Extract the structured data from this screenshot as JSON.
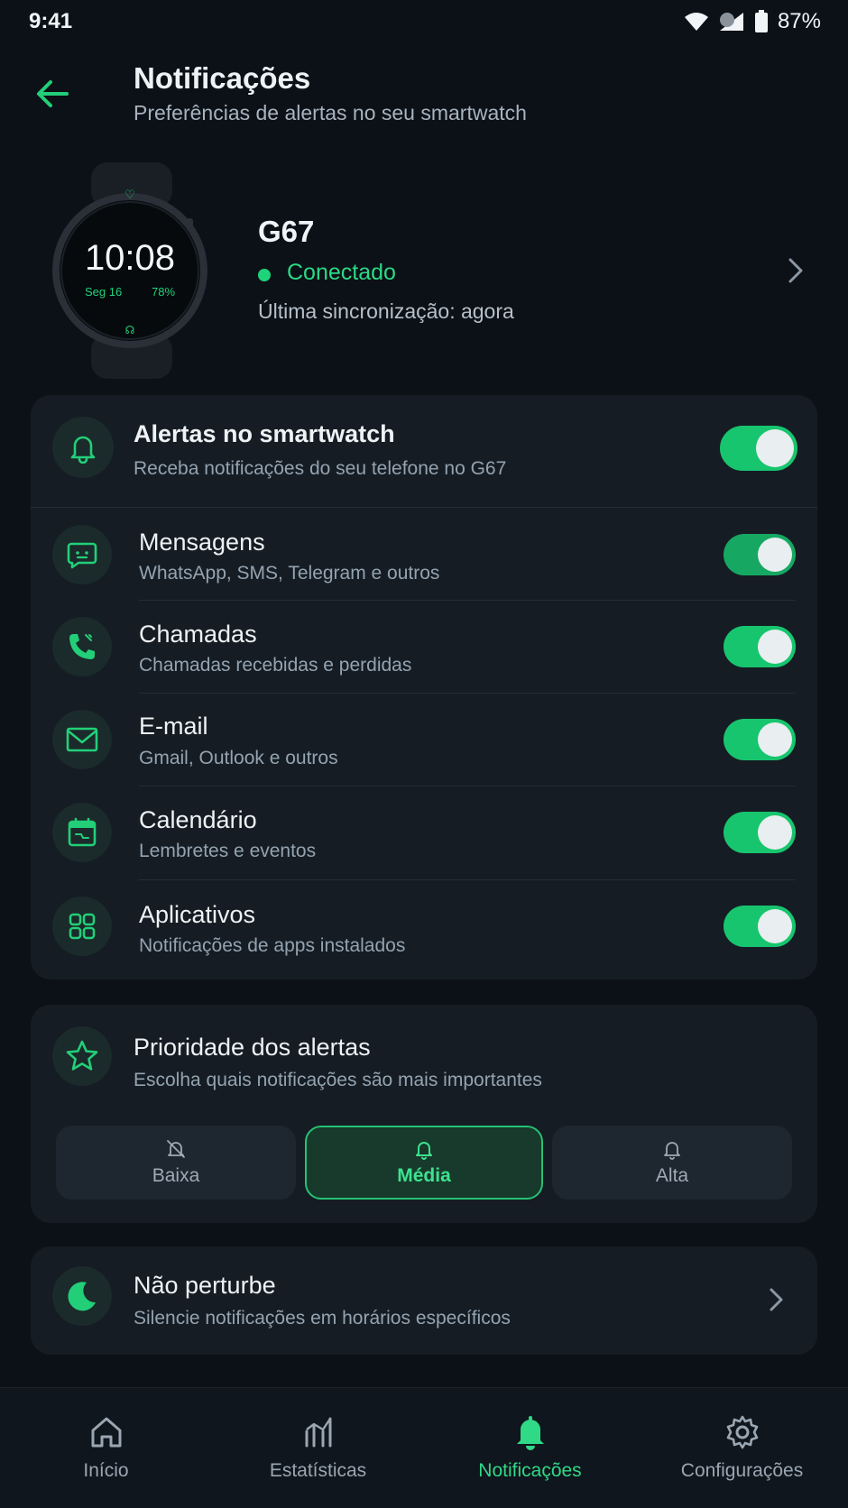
{
  "status_bar": {
    "time": "9:41",
    "battery": "87%"
  },
  "header": {
    "title": "Notificações",
    "subtitle": "Preferências de alertas no seu smartwatch"
  },
  "device": {
    "watch_time": "10:08",
    "watch_date": "Seg 16",
    "watch_battery": "78%",
    "name": "G67",
    "status": "Conectado",
    "sync": "Última sincronização: agora"
  },
  "alerts": {
    "master": {
      "title": "Alertas no smartwatch",
      "subtitle": "Receba notificações do seu telefone no G67",
      "enabled": true
    },
    "items": [
      {
        "title": "Mensagens",
        "subtitle": "WhatsApp, SMS, Telegram e outros",
        "icon": "message-icon",
        "enabled": true
      },
      {
        "title": "Chamadas",
        "subtitle": "Chamadas recebidas e perdidas",
        "icon": "phone-icon",
        "enabled": true
      },
      {
        "title": "E-mail",
        "subtitle": "Gmail, Outlook e outros",
        "icon": "mail-icon",
        "enabled": true
      },
      {
        "title": "Calendário",
        "subtitle": "Lembretes e eventos",
        "icon": "calendar-icon",
        "enabled": true
      },
      {
        "title": "Aplicativos",
        "subtitle": "Notificações de apps instalados",
        "icon": "apps-grid-icon",
        "enabled": true
      }
    ]
  },
  "priority": {
    "title": "Prioridade dos alertas",
    "subtitle": "Escolha quais notificações são mais importantes",
    "options": [
      "Baixa",
      "Média",
      "Alta"
    ],
    "selected": "Média"
  },
  "dnd": {
    "title": "Não perturbe",
    "subtitle": "Silencie notificações em horários específicos"
  },
  "nav": {
    "items": [
      "Início",
      "Estatísticas",
      "Notificações",
      "Configurações"
    ],
    "active": "Notificações"
  },
  "colors": {
    "accent": "#1fd37a",
    "background": "#0c1117",
    "card": "#151c24"
  }
}
